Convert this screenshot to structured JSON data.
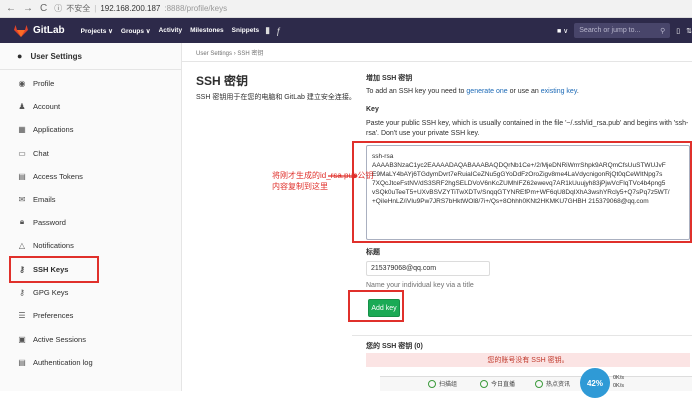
{
  "browser": {
    "warning": "不安全",
    "url_host": "192.168.200.187",
    "url_rest": ":8888/profile/keys"
  },
  "header": {
    "brand": "GitLab",
    "menu": [
      "Projects ∨",
      "Groups ∨",
      "Activity",
      "Milestones",
      "Snippets"
    ],
    "search_placeholder": "Search or jump to..."
  },
  "sidebar": {
    "title": "User Settings",
    "items": [
      {
        "label": "Profile",
        "icon": "profile-icon"
      },
      {
        "label": "Account",
        "icon": "account-icon"
      },
      {
        "label": "Applications",
        "icon": "applications-icon"
      },
      {
        "label": "Chat",
        "icon": "chat-icon"
      },
      {
        "label": "Access Tokens",
        "icon": "token-icon"
      },
      {
        "label": "Emails",
        "icon": "email-icon"
      },
      {
        "label": "Password",
        "icon": "lock-icon"
      },
      {
        "label": "Notifications",
        "icon": "bell-icon"
      },
      {
        "label": "SSH Keys",
        "icon": "key-icon"
      },
      {
        "label": "GPG Keys",
        "icon": "gpg-key-icon"
      },
      {
        "label": "Preferences",
        "icon": "sliders-icon"
      },
      {
        "label": "Active Sessions",
        "icon": "sessions-icon"
      },
      {
        "label": "Authentication log",
        "icon": "log-icon"
      }
    ]
  },
  "breadcrumb": {
    "parent": "User Settings",
    "sep": "›",
    "current": "SSH 密钥"
  },
  "page": {
    "title": "SSH 密钥",
    "intro": "SSH 密钥用于在您的电脑和 GitLab 建立安全连接。"
  },
  "add": {
    "heading": "增加 SSH 密钥",
    "desc_pre": "To add an SSH key you need to ",
    "desc_link1": "generate one",
    "desc_mid": " or use an ",
    "desc_link2": "existing key",
    "desc_post": ".",
    "key_label": "Key",
    "key_help": "Paste your public SSH key, which is usually contained in the file '~/.ssh/id_rsa.pub' and begins with 'ssh-rsa'. Don't use your private SSH key.",
    "key_value": "ssh-rsa\nAAAAB3NzaC1yc2EAAAADAQABAAABAQDQrNb1Ce+/2/MjeDNRiWrrrShpk9ARQmCfsUuSTWUJvF\nE9MaLY4bAYj6TGdymDvrt7eRuiaICeZNu5gGYoDdFzOroZigv8me4LaVdycnigonRjQt0qCeWItNpg7s\n7XQcJtceFstNV/dS3SRF2hgSELDVoV6nKcZUMhIFZ62ewevq7AR1kUuujyh83jPjwVcFIqTVc4b4png5\nvSQk0uTeeT5+UXvBSVZYTiTwXDTv/SnqqGTYNREfPm+WF6qU8DqIXhA3wshYRcly5+Q7sPq7z5WT/\n+QiIeHnLZ/iVIu9Pw7JRS7bHktWOl8/7i+/Qs+8Ohhh0KNt2HKMKU7GHBH 215379068@qq.com",
    "title_label": "标题",
    "title_value": "215379068@qq.com",
    "title_help": "Name your individual key via a title",
    "submit": "Add key"
  },
  "keys": {
    "heading": "您的 SSH 密钥 (0)",
    "empty": "您的账号没有 SSH 密钥。"
  },
  "annotation": "将刚才生成的id_rsa.pub公钥\n内容复制到这里",
  "taskbar": {
    "item1": "扫描组",
    "item2": "今日直播",
    "item3": "热点资讯",
    "gauge": "42%",
    "up": "0K/s",
    "down": "0K/s"
  },
  "colors": {
    "header": "#2d2a4a",
    "accent": "#e0302b",
    "button": "#1aaa55",
    "link": "#1b69b6"
  }
}
